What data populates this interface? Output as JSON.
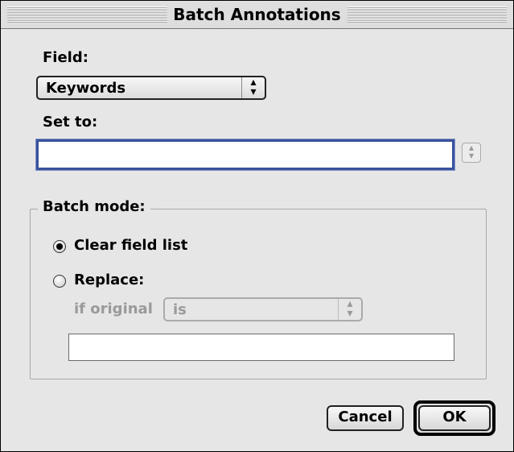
{
  "dialog": {
    "title": "Batch Annotations",
    "field_label": "Field:",
    "field_value": "Keywords",
    "set_to_label": "Set to:",
    "set_to_value": "",
    "batch_mode_title": "Batch mode:",
    "clear_label": "Clear field list",
    "replace_label": "Replace:",
    "if_original_label": "if original",
    "if_original_value": "is",
    "replace_value": "",
    "cancel_label": "Cancel",
    "ok_label": "OK"
  }
}
